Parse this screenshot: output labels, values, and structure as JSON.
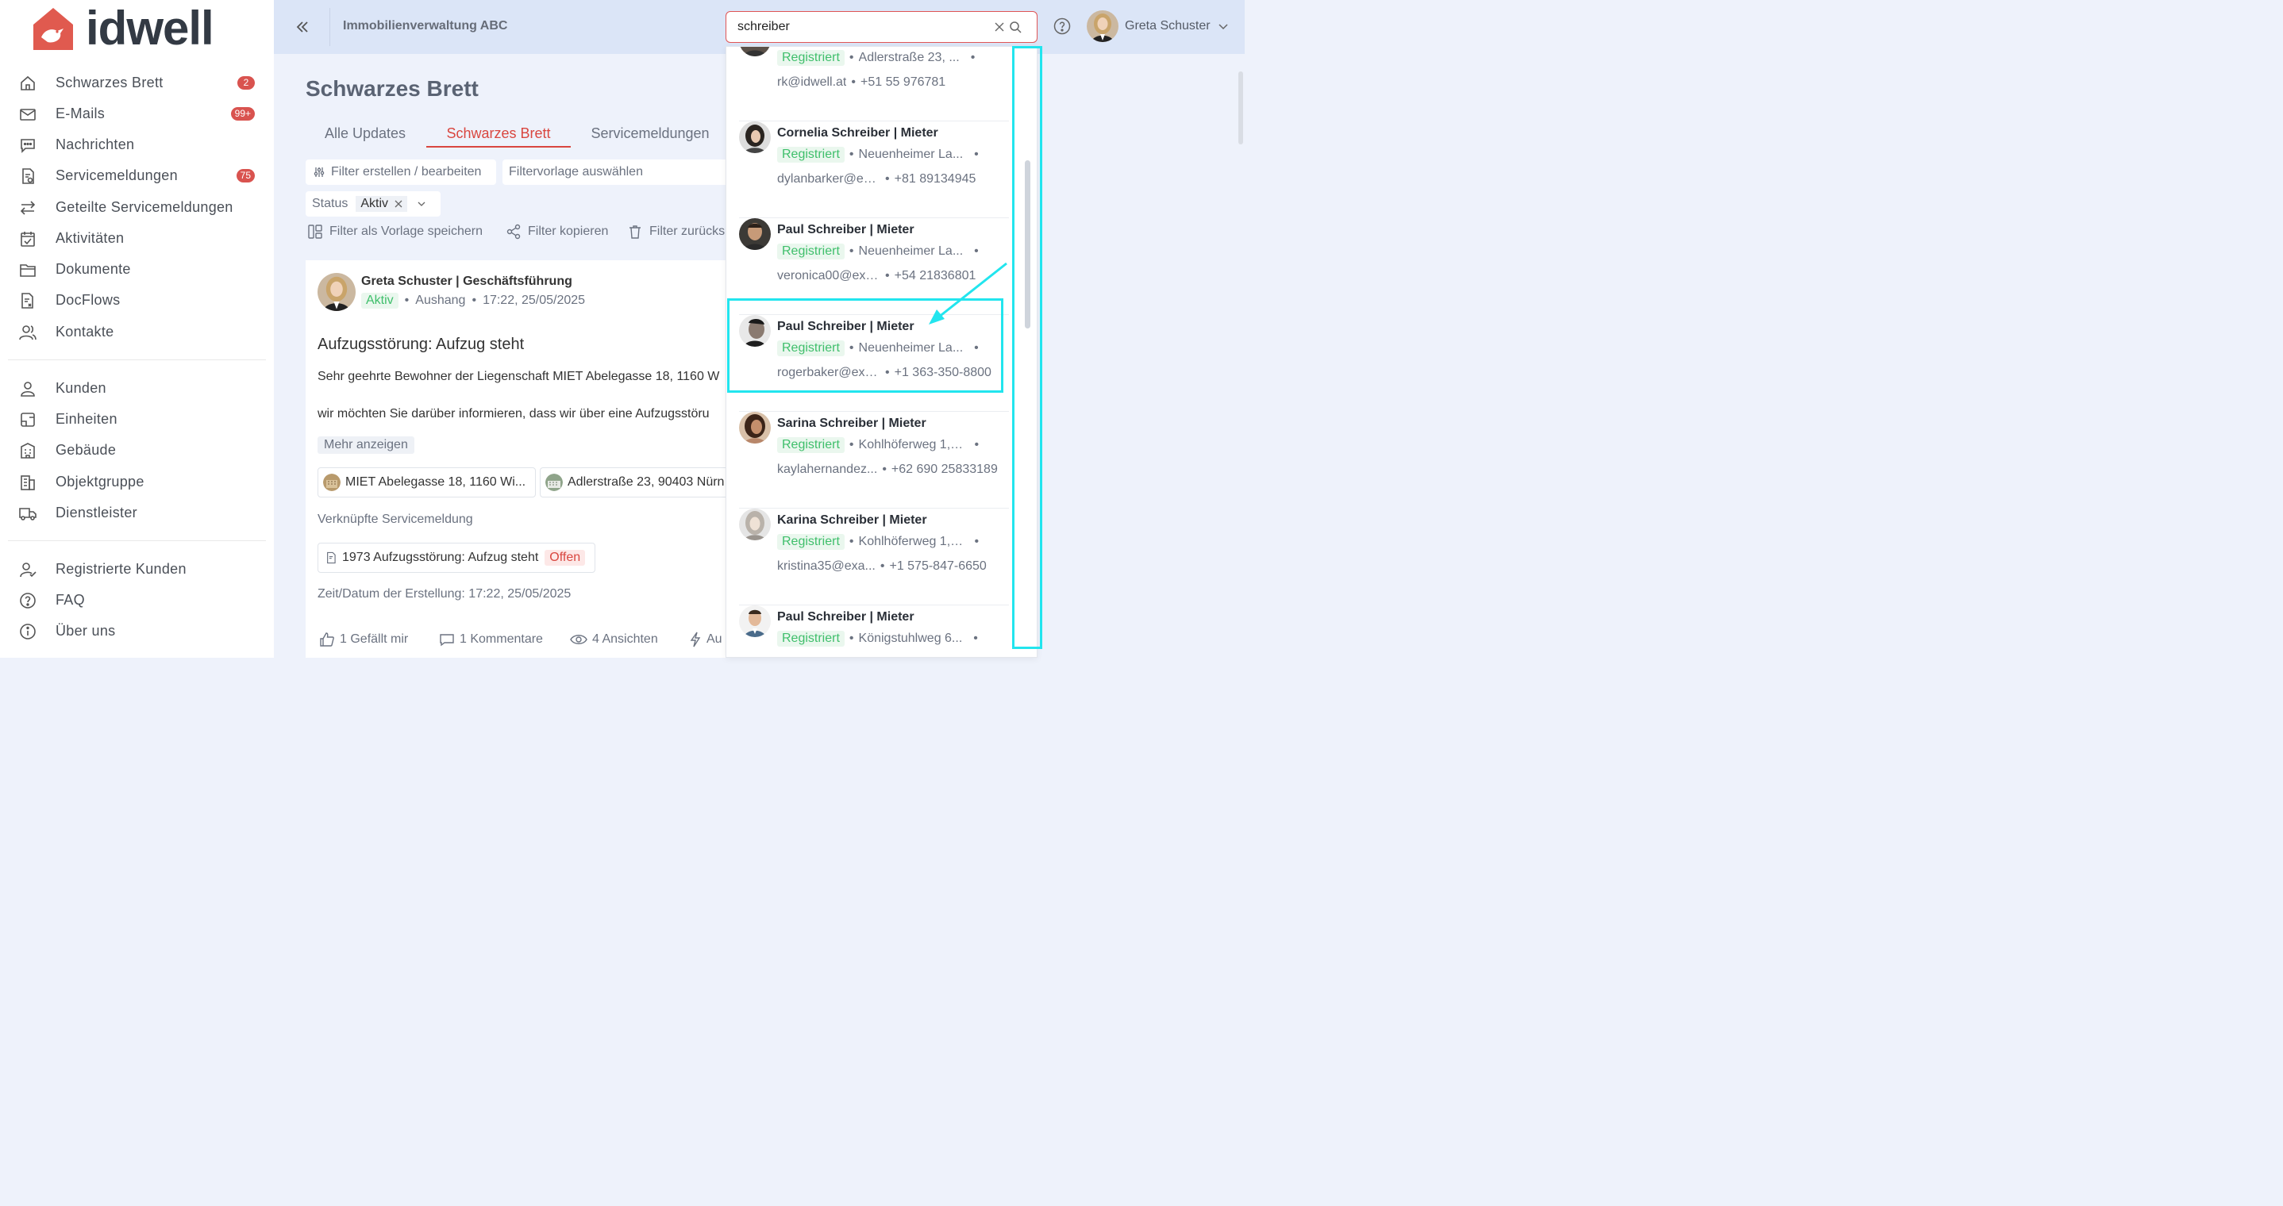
{
  "brand": {
    "name": "idwell",
    "color": "#e05a4f"
  },
  "sidebar": {
    "items": [
      {
        "label": "Schwarzes Brett",
        "icon": "home-icon",
        "badge": "2"
      },
      {
        "label": "E-Mails",
        "icon": "mail-icon",
        "badge": "99+"
      },
      {
        "label": "Nachrichten",
        "icon": "chat-icon",
        "badge": null
      },
      {
        "label": "Servicemeldungen",
        "icon": "service-report-icon",
        "badge": "75"
      },
      {
        "label": "Geteilte Servicemeldungen",
        "icon": "swap-arrows-icon",
        "badge": null
      },
      {
        "label": "Aktivitäten",
        "icon": "calendar-check-icon",
        "badge": null
      },
      {
        "label": "Dokumente",
        "icon": "folder-icon",
        "badge": null
      },
      {
        "label": "DocFlows",
        "icon": "docflow-icon",
        "badge": null
      },
      {
        "label": "Kontakte",
        "icon": "contacts-icon",
        "badge": null
      },
      {
        "label": "Kunden",
        "icon": "user-icon",
        "badge": null
      },
      {
        "label": "Einheiten",
        "icon": "unit-icon",
        "badge": null
      },
      {
        "label": "Gebäude",
        "icon": "building-icon",
        "badge": null
      },
      {
        "label": "Objektgruppe",
        "icon": "building-group-icon",
        "badge": null
      },
      {
        "label": "Dienstleister",
        "icon": "truck-icon",
        "badge": null
      },
      {
        "label": "Registrierte Kunden",
        "icon": "user-check-icon",
        "badge": null
      },
      {
        "label": "FAQ",
        "icon": "question-icon",
        "badge": null
      },
      {
        "label": "Über uns",
        "icon": "info-icon",
        "badge": null
      }
    ]
  },
  "header": {
    "org": "Immobilienverwaltung ABC",
    "search_value": "schreiber",
    "user_name": "Greta Schuster"
  },
  "main": {
    "title": "Schwarzes Brett",
    "tabs": [
      {
        "label": "Alle Updates",
        "active": false
      },
      {
        "label": "Schwarzes Brett",
        "active": true
      },
      {
        "label": "Servicemeldungen",
        "active": false
      }
    ],
    "filter_edit": "Filter erstellen / bearbeiten",
    "filter_template": "Filtervorlage auswählen",
    "status_label": "Status",
    "status_value": "Aktiv",
    "save_template": "Filter als Vorlage speichern",
    "copy_filter": "Filter kopieren",
    "reset_filter": "Filter zurücks",
    "post": {
      "author": "Greta Schuster | Geschäftsführung",
      "status": "Aktiv",
      "type": "Aushang",
      "datetime": "17:22, 25/05/2025",
      "title": "Aufzugsstörung: Aufzug steht",
      "text1": "Sehr geehrte Bewohner der Liegenschaft MIET Abelegasse 18, 1160 W",
      "text2": "wir möchten Sie darüber informieren, dass wir über eine Aufzugsstöru",
      "more": "Mehr anzeigen",
      "chips": [
        "MIET Abelegasse 18, 1160 Wi...",
        "Adlerstraße 23, 90403 Nürn"
      ],
      "linked_label": "Verknüpfte Servicemeldung",
      "linked_ticket": "1973 Aufzugsstörung: Aufzug steht",
      "linked_status": "Offen",
      "created": "Zeit/Datum der Erstellung: 17:22, 25/05/2025",
      "likes": "1 Gefällt mir",
      "comments": "1 Kommentare",
      "views": "4 Ansichten",
      "extra": "Au"
    }
  },
  "results": [
    {
      "name": "",
      "status": "Registriert",
      "address": "Adlerstraße 23, ...",
      "email": "rk@idwell.at",
      "phone": "+51 55 976781"
    },
    {
      "name": "Cornelia Schreiber | Mieter",
      "status": "Registriert",
      "address": "Neuenheimer La...",
      "email": "dylanbarker@ex...",
      "phone": "+81 89134945"
    },
    {
      "name": "Paul Schreiber | Mieter",
      "status": "Registriert",
      "address": "Neuenheimer La...",
      "email": "veronica00@exa...",
      "phone": "+54 21836801"
    },
    {
      "name": "Paul Schreiber | Mieter",
      "status": "Registriert",
      "address": "Neuenheimer La...",
      "email": "rogerbaker@exa...",
      "phone": "+1 363-350-8800"
    },
    {
      "name": "Sarina Schreiber | Mieter",
      "status": "Registriert",
      "address": "Kohlhöferweg 1, ...",
      "email": "kaylahernandez...",
      "phone": "+62 690 25833189"
    },
    {
      "name": "Karina Schreiber | Mieter",
      "status": "Registriert",
      "address": "Kohlhöferweg 1, ...",
      "email": "kristina35@exa...",
      "phone": "+1 575-847-6650"
    },
    {
      "name": "Paul Schreiber | Mieter",
      "status": "Registriert",
      "address": "Königstuhlweg 6...",
      "email": "",
      "phone": ""
    }
  ],
  "colors": {
    "accent": "#d9463f",
    "annotation": "#22e5ee",
    "registered": "#3fbf6b",
    "header_bg": "#dbe5f7"
  }
}
